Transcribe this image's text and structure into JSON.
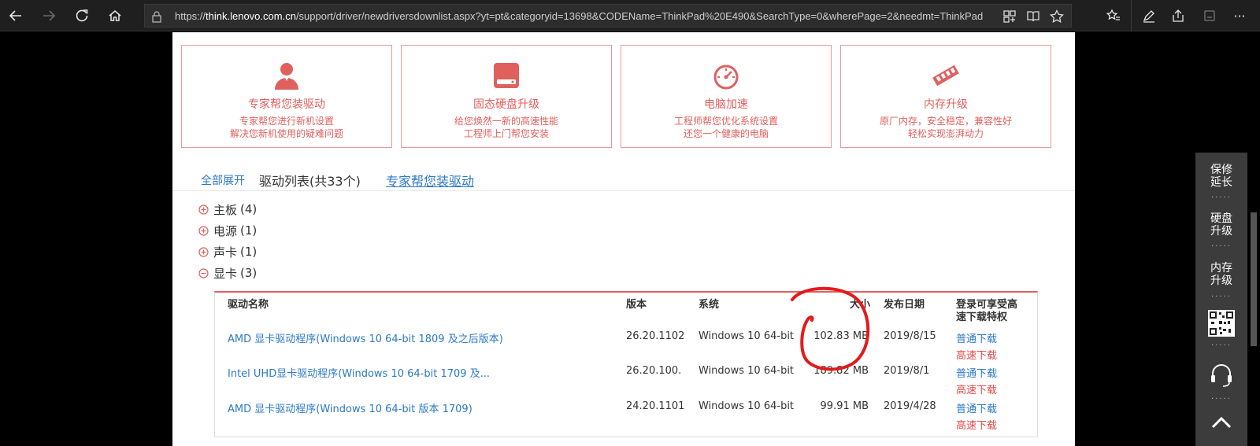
{
  "browser": {
    "url_prefix": "https://",
    "url_host": "think.lenovo.com.cn",
    "url_rest": "/support/driver/newdriversdownlist.aspx?yt=pt&categoryid=13698&CODEName=ThinkPad%20E490&SearchType=0&wherePage=2&needmt=ThinkPad",
    "more_label": "···"
  },
  "services": [
    {
      "title": "专家帮您装驱动",
      "desc1": "专家帮您进行新机设置",
      "desc2": "解决您新机使用的疑难问题",
      "icon": "expert-person-icon"
    },
    {
      "title": "固态硬盘升级",
      "desc1": "给您焕然一新的高速性能",
      "desc2": "工程师上门帮您安装",
      "icon": "ssd-drive-icon"
    },
    {
      "title": "电脑加速",
      "desc1": "工程师帮您优化系统设置",
      "desc2": "还您一个健康的电脑",
      "icon": "speedometer-icon"
    },
    {
      "title": "内存升级",
      "desc1": "原厂内存，安全稳定，兼容性好",
      "desc2": "轻松实现澎湃动力",
      "icon": "memory-stick-icon"
    }
  ],
  "tabs": {
    "expand_all": "全部展开",
    "list_title": "驱动列表(共33个)",
    "expert_link": "专家帮您装驱动"
  },
  "categories": [
    {
      "name": "主板",
      "count": "(4)",
      "expanded": false
    },
    {
      "name": "电源",
      "count": "(1)",
      "expanded": false
    },
    {
      "name": "声卡",
      "count": "(1)",
      "expanded": false
    },
    {
      "name": "显卡",
      "count": "(3)",
      "expanded": true
    }
  ],
  "table": {
    "headers": {
      "name": "驱动名称",
      "version": "版本",
      "system": "系统",
      "size": "大小",
      "date": "发布日期",
      "download1": "登录可享受高",
      "download2": "速下载特权"
    },
    "rows": [
      {
        "name": "AMD 显卡驱动程序(Windows 10 64-bit 1809 及之后版本)",
        "version": "26.20.1102",
        "system": "Windows 10 64-bit",
        "size": "102.83 MB",
        "date": "2019/8/15",
        "normal": "普通下载",
        "fast": "高速下载"
      },
      {
        "name": "Intel UHD显卡驱动程序(Windows 10 64-bit 1709 及...",
        "version": "26.20.100.",
        "system": "Windows 10 64-bit",
        "size": "189.82 MB",
        "date": "2019/8/1",
        "normal": "普通下载",
        "fast": "高速下载"
      },
      {
        "name": "AMD 显卡驱动程序(Windows 10 64-bit 版本 1709)",
        "version": "24.20.1101",
        "system": "Windows 10 64-bit",
        "size": "99.91 MB",
        "date": "2019/4/28",
        "normal": "普通下载",
        "fast": "高速下载"
      }
    ]
  },
  "side_bar": {
    "items": [
      {
        "line1": "保修",
        "line2": "延长"
      },
      {
        "line1": "硬盘",
        "line2": "升级"
      },
      {
        "line1": "内存",
        "line2": "升级"
      }
    ],
    "dots": "·····"
  },
  "colors": {
    "accent": "#e0605e",
    "link": "#2b79c6",
    "fast": "#e04848",
    "annotation": "#e11b1b"
  }
}
